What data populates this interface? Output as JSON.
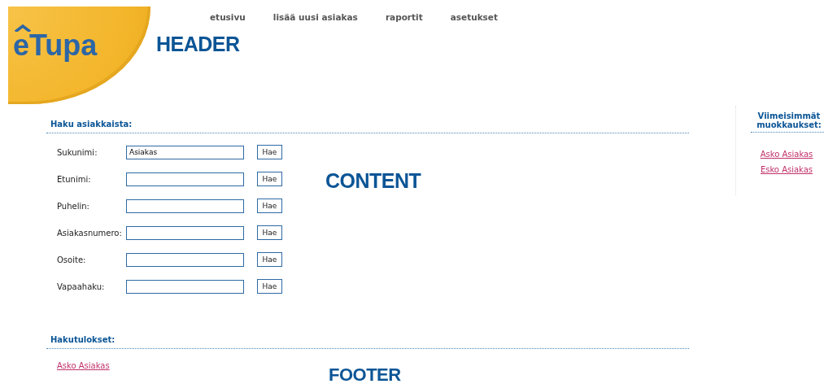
{
  "logo": "eTupa",
  "nav": [
    "etusivu",
    "lisää uusi asiakas",
    "raportit",
    "asetukset"
  ],
  "header_label": "HEADER",
  "search": {
    "title": "Haku asiakkaista:",
    "fields": [
      {
        "label": "Sukunimi:",
        "value": "Asiakas",
        "button": "Hae"
      },
      {
        "label": "Etunimi:",
        "button": "Hae"
      },
      {
        "label": "Puhelin:",
        "button": "Hae"
      },
      {
        "label": "Asiakasnumero:",
        "button": "Hae"
      },
      {
        "label": "Osoite:",
        "button": "Hae"
      },
      {
        "label": "Vapaahaku:",
        "button": "Hae"
      }
    ]
  },
  "content_label": "CONTENT",
  "results": {
    "title": "Hakutulokset:",
    "links": [
      "Asko Asiakas"
    ]
  },
  "footer_label": "FOOTER",
  "sidebar": {
    "title": "Viimeisimmät muokkaukset:",
    "links": [
      "Asko Asiakas",
      "Esko Asiakas"
    ]
  }
}
